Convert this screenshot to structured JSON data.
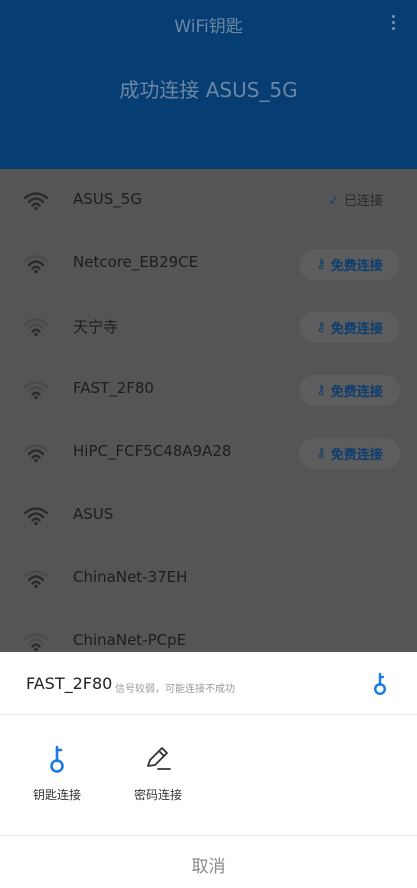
{
  "header": {
    "app_title": "WiFi钥匙",
    "headline": "成功连接 ASUS_5G"
  },
  "networks": [
    {
      "ssid": "ASUS_5G",
      "signal": 4,
      "action": "已连接"
    },
    {
      "ssid": "Netcore_EB29CE",
      "signal": 3,
      "action": "免费连接"
    },
    {
      "ssid": "天宁寺",
      "signal": 2,
      "action": "免费连接"
    },
    {
      "ssid": "FAST_2F80",
      "signal": 2,
      "action": "免费连接"
    },
    {
      "ssid": "HiPC_FCF5C48A9A28",
      "signal": 3,
      "action": "免费连接"
    },
    {
      "ssid": "ASUS",
      "signal": 4,
      "action": ""
    },
    {
      "ssid": "ChinaNet-37EH",
      "signal": 3,
      "action": ""
    },
    {
      "ssid": "ChinaNet-PCpE",
      "signal": 2,
      "action": ""
    }
  ],
  "sheet": {
    "ssid": "FAST_2F80",
    "note": "信号较弱，可能连接不成功",
    "options": [
      {
        "label": "钥匙连接",
        "icon": "key-icon"
      },
      {
        "label": "密码连接",
        "icon": "pencil-icon"
      }
    ],
    "cancel": "取消"
  },
  "colors": {
    "accent": "#1a7ce0",
    "header_dimmed": "#063e73",
    "overlay": "#555555"
  }
}
